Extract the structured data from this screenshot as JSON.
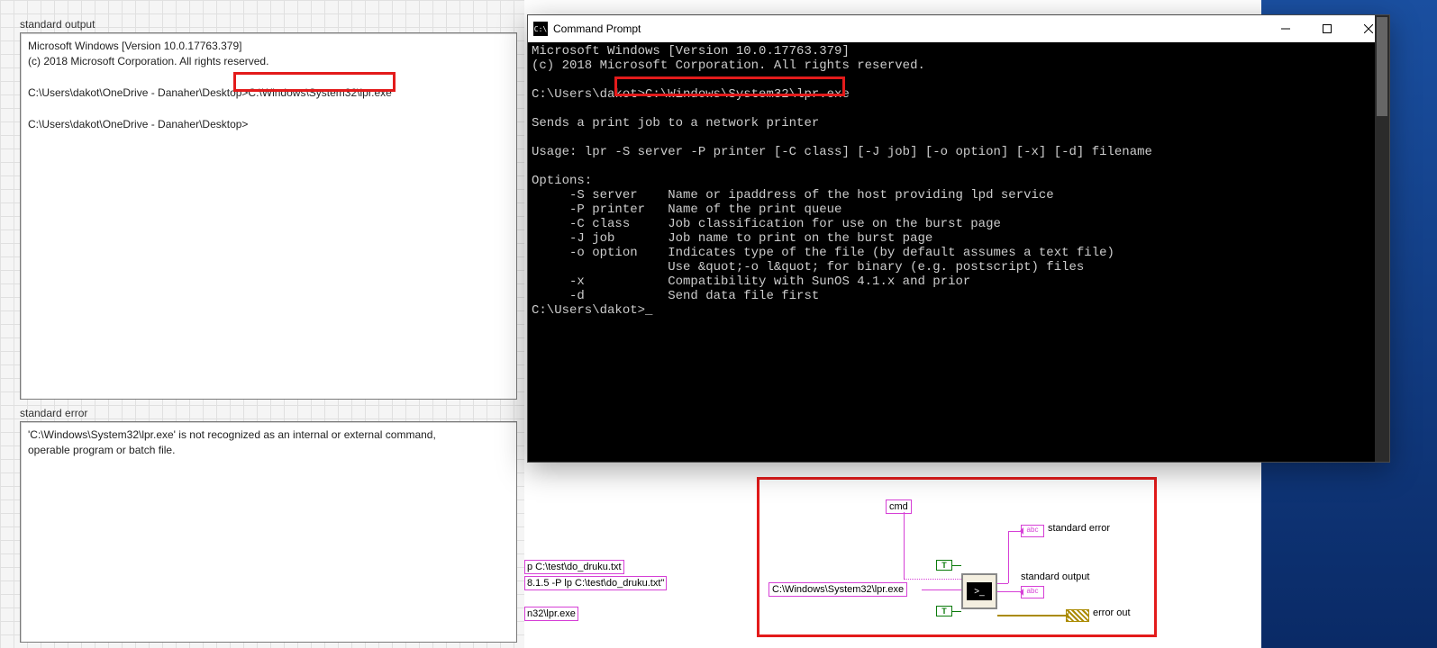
{
  "fp": {
    "stdout_label": "standard output",
    "stdout_text": "Microsoft Windows [Version 10.0.17763.379]\n(c) 2018 Microsoft Corporation. All rights reserved.\n\nC:\\Users\\dakot\\OneDrive - Danaher\\Desktop>C:\\Windows\\System32\\lpr.exe\n\nC:\\Users\\dakot\\OneDrive - Danaher\\Desktop>",
    "stderr_label": "standard error",
    "stderr_text": "'C:\\Windows\\System32\\lpr.exe' is not recognized as an internal or external command,\noperable program or batch file."
  },
  "cmd": {
    "title": "Command Prompt",
    "body": "Microsoft Windows [Version 10.0.17763.379]\n(c) 2018 Microsoft Corporation. All rights reserved.\n\nC:\\Users\\dakot>C:\\Windows\\System32\\lpr.exe\n\nSends a print job to a network printer\n\nUsage: lpr -S server -P printer [-C class] [-J job] [-o option] [-x] [-d] filename\n\nOptions:\n     -S server    Name or ipaddress of the host providing lpd service\n     -P printer   Name of the print queue\n     -C class     Job classification for use on the burst page\n     -J job       Job name to print on the burst page\n     -o option    Indicates type of the file (by default assumes a text file)\n                  Use &quot;-o l&quot; for binary (e.g. postscript) files\n     -x           Compatibility with SunOS 4.1.x and prior\n     -d           Send data file first\nC:\\Users\\dakot>_"
  },
  "frag": {
    "s1": "p C:\\test\\do_druku.txt",
    "s2": "8.1.5 -P lp C:\\test\\do_druku.txt\"",
    "s3": "n32\\lpr.exe"
  },
  "bd": {
    "cmd_str": "cmd",
    "path_str": "C:\\Windows\\System32\\lpr.exe",
    "stderr_label": "standard error",
    "stdout_label": "standard output",
    "errout_label": "error out",
    "bool_true": "T",
    "abc": "abc"
  }
}
